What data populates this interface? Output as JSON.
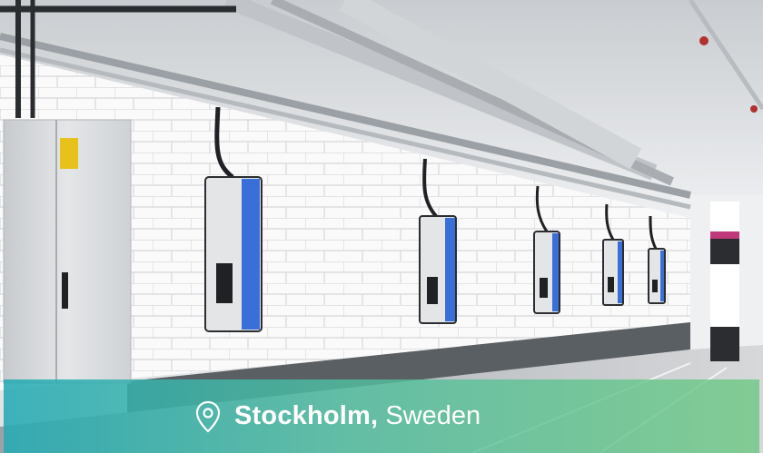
{
  "caption": {
    "city": "Stockholm,",
    "country": "Sweden",
    "icon": "location-pin-icon"
  },
  "colors": {
    "caption_gradient_start": "#26aab4",
    "caption_gradient_end": "#6ec882",
    "charger_accent": "#3b6fd8"
  }
}
